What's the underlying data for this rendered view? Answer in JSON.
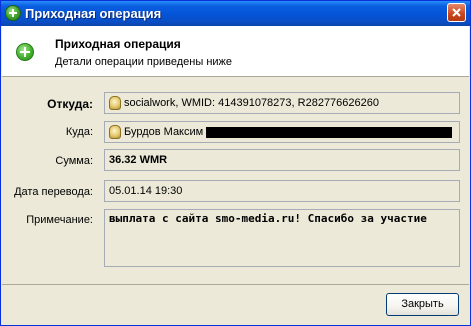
{
  "window": {
    "title": "Приходная операция"
  },
  "header": {
    "title": "Приходная операция",
    "subtitle": "Детали операции приведены ниже"
  },
  "fields": {
    "from_label": "Откуда:",
    "from_value": "socialwork, WMID: 414391078273, R282776626260",
    "to_label": "Куда:",
    "to_value": "Бурдов Максим",
    "amount_label": "Сумма:",
    "amount_value": "36.32 WMR",
    "date_label": "Дата перевода:",
    "date_value": "05.01.14 19:30",
    "note_label": "Примечание:",
    "note_value": "выплата с сайта smo-media.ru! Спасибо за участие"
  },
  "buttons": {
    "close_label": "Закрыть"
  },
  "icons": {
    "title": "green-plus-icon",
    "header": "green-plus-icon",
    "purse": "wm-purse-icon",
    "close": "close-icon"
  },
  "colors": {
    "titlebar": "#0553d6",
    "window_bg": "#ece9d8",
    "close_button": "#c9451c",
    "header_icon": "#46b030"
  }
}
